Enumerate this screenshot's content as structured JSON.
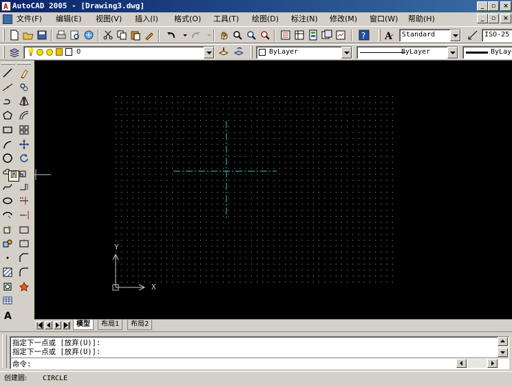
{
  "window": {
    "title": "AutoCAD 2005 - [Drawing3.dwg]"
  },
  "menu": [
    "文件(F)",
    "编辑(E)",
    "视图(V)",
    "插入(I)",
    "格式(O)",
    "工具(T)",
    "绘图(D)",
    "标注(N)",
    "修改(M)",
    "窗口(W)",
    "帮助(H)"
  ],
  "toolbar": {
    "text_style": "Standard",
    "dim_style": "ISO-25"
  },
  "layers": {
    "current": "0",
    "color": "ByLayer",
    "linetype": "ByLayer",
    "lineweight": "ByLayer"
  },
  "tooltip": {
    "glyph": "圆"
  },
  "ucs": {
    "x_label": "X",
    "y_label": "Y"
  },
  "layout_tabs": [
    "模型",
    "布局1",
    "布局2"
  ],
  "command": {
    "history": [
      "指定下一点或 [放弃(U)]:",
      "指定下一点或 [放弃(U)]:"
    ],
    "prompt": "命令:"
  },
  "status": {
    "label": "创建圆:",
    "value": "CIRCLE"
  },
  "colors": {
    "canvas_bg": "#000000",
    "grid": "#c0c0c0",
    "crosshair": "#3fc9c9",
    "title_bar": "#0a246a"
  },
  "icons": {
    "draw": [
      "line-icon",
      "construction-line-icon",
      "polyline-icon",
      "polygon-icon",
      "rectangle-icon",
      "arc-icon",
      "circle-icon",
      "revision-cloud-icon",
      "spline-icon",
      "ellipse-icon",
      "ellipse-arc-icon",
      "insert-block-icon",
      "make-block-icon",
      "point-icon",
      "hatch-icon",
      "region-icon",
      "table-icon",
      "multiline-text-icon"
    ],
    "modify": [
      "erase-icon",
      "copy-icon",
      "mirror-icon",
      "offset-icon",
      "array-icon",
      "move-icon",
      "rotate-icon",
      "scale-icon",
      "stretch-icon",
      "trim-icon",
      "extend-icon",
      "break-at-point-icon",
      "break-icon",
      "chamfer-icon",
      "fillet-icon",
      "explode-icon"
    ]
  }
}
